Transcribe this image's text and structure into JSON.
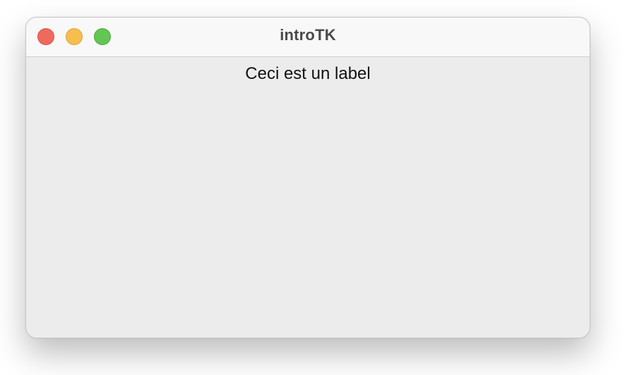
{
  "window": {
    "title": "introTK"
  },
  "traffic_lights": {
    "close_color": "#ee6a5e",
    "minimize_color": "#f5be4f",
    "zoom_color": "#62c554"
  },
  "content": {
    "label_text": "Ceci est un label"
  }
}
